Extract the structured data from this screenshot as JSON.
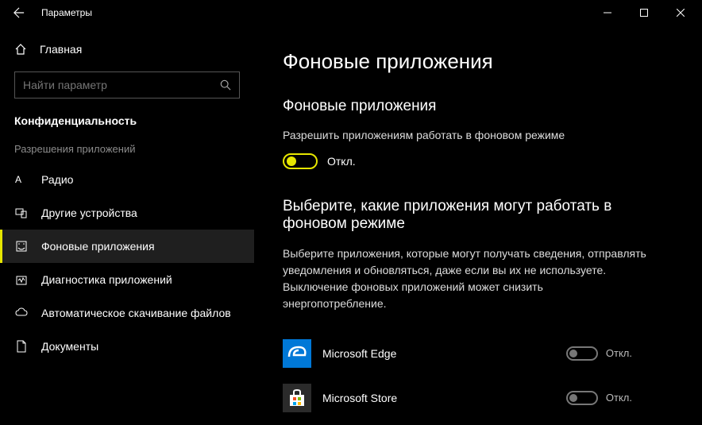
{
  "titlebar": {
    "title": "Параметры"
  },
  "sidebar": {
    "home": "Главная",
    "search_placeholder": "Найти параметр",
    "section": "Конфиденциальность",
    "group": "Разрешения приложений",
    "items": [
      {
        "label": "Радио"
      },
      {
        "label": "Другие устройства"
      },
      {
        "label": "Фоновые приложения"
      },
      {
        "label": "Диагностика приложений"
      },
      {
        "label": "Автоматическое скачивание файлов"
      },
      {
        "label": "Документы"
      }
    ]
  },
  "content": {
    "title": "Фоновые приложения",
    "sub1": "Фоновые приложения",
    "desc1": "Разрешить приложениям работать в фоновом режиме",
    "master_state": "Откл.",
    "sub2": "Выберите, какие приложения могут работать в фоновом режиме",
    "desc2": "Выберите приложения, которые могут получать сведения, отправлять уведомления и обновляться, даже если вы их не используете. Выключение фоновых приложений может снизить энергопотребление.",
    "apps": [
      {
        "name": "Microsoft Edge",
        "state": "Откл."
      },
      {
        "name": "Microsoft Store",
        "state": "Откл."
      }
    ]
  }
}
